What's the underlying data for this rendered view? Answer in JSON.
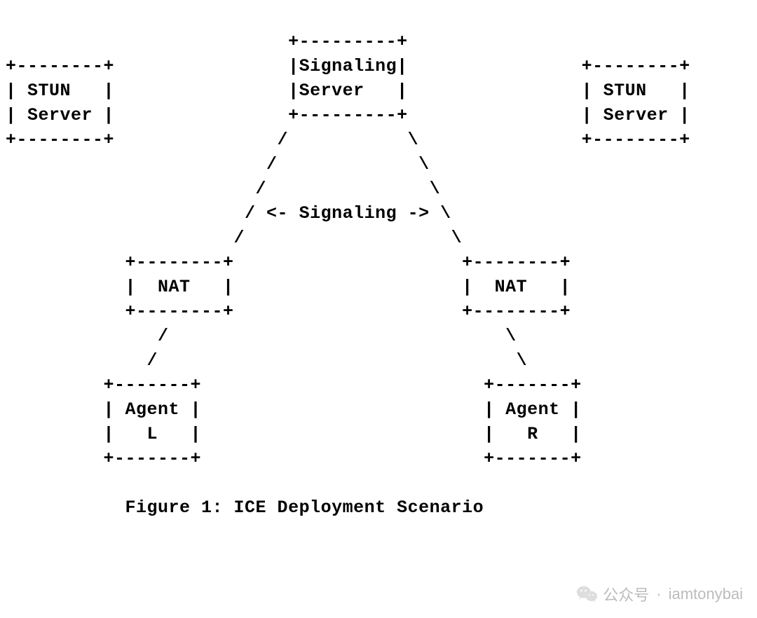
{
  "diagram": {
    "lines": [
      "                          +---------+",
      "+--------+                |Signaling|                +--------+",
      "| STUN   |                |Server   |                | STUN   |",
      "| Server |                +---------+                | Server |",
      "+--------+               /           \\               +--------+",
      "                        /             \\",
      "                       /               \\",
      "                      / <- Signaling -> \\",
      "                     /                   \\",
      "           +--------+                     +--------+",
      "           |  NAT   |                     |  NAT   |",
      "           +--------+                     +--------+",
      "              /                               \\",
      "             /                                 \\",
      "         +-------+                          +-------+",
      "         | Agent |                          | Agent |",
      "         |   L   |                          |   R   |",
      "         +-------+                          +-------+",
      "",
      "           Figure 1: ICE Deployment Scenario"
    ],
    "nodes": {
      "stun_left": "STUN Server",
      "signaling_server": "Signaling Server",
      "stun_right": "STUN Server",
      "signaling_label": "<- Signaling ->",
      "nat_left": "NAT",
      "nat_right": "NAT",
      "agent_left": "Agent L",
      "agent_right": "Agent R"
    },
    "caption": "Figure 1: ICE Deployment Scenario"
  },
  "watermark": {
    "label": "公众号",
    "separator": "·",
    "handle": "iamtonybai"
  }
}
